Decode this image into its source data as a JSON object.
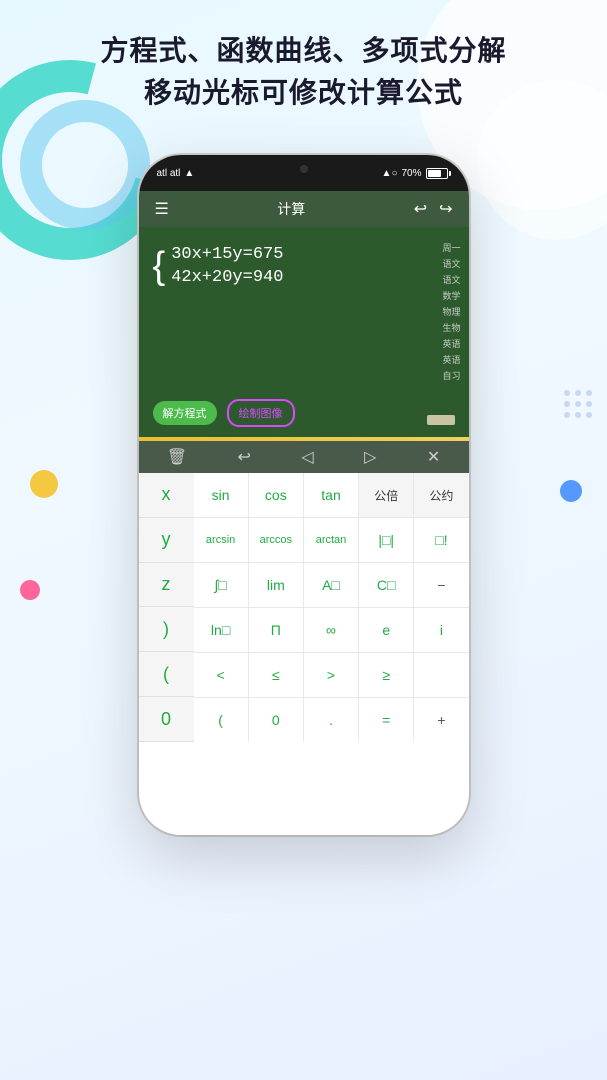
{
  "header": {
    "line1": "方程式、函数曲线、多项式分解",
    "line2": "移动光标可修改计算公式"
  },
  "phone": {
    "status": {
      "left": "atl atl",
      "wifi": "▲",
      "time": "▲ ○",
      "battery_pct": "70%"
    },
    "toolbar": {
      "menu_icon": "☰",
      "title": "计算",
      "undo_icon": "↩",
      "redo_icon": "↪"
    },
    "chalkboard": {
      "equation1": "30x+15y=675",
      "equation2": "42x+20y=940",
      "sidebar_labels": [
        "周一",
        "语文",
        "语文",
        "数学",
        "物理",
        "生物",
        "英语",
        "英语",
        "自习"
      ],
      "btn_solve": "解方程式",
      "btn_draw": "绘制图像"
    },
    "action_bar": {
      "icons": [
        "🗑",
        "↩",
        "◁",
        "▷",
        "✕"
      ]
    },
    "keyboard": {
      "left_keys": [
        "x",
        "y",
        "z",
        ")",
        "(",
        "0"
      ],
      "row1": [
        "sin",
        "cos",
        "tan",
        "公倍",
        "公约"
      ],
      "row2": [
        "arcsin",
        "arccos",
        "arctan",
        "|□|",
        "□!"
      ],
      "row3": [
        "∫□",
        "lim",
        "A□",
        "C□",
        "−"
      ],
      "row4": [
        "ln□",
        "Π",
        "∞",
        "e",
        "i"
      ],
      "row5": [
        "<",
        "≤",
        ">",
        "≥",
        ""
      ],
      "row6": [
        "(",
        "0",
        ".",
        "=",
        "+"
      ]
    }
  },
  "colors": {
    "teal": "#3dd8c8",
    "blue": "#5599ff",
    "yellow": "#f5c842",
    "pink": "#ff6699",
    "green_text": "#22aa44",
    "chalkboard": "#2d5a2d",
    "toolbar": "#3d5a3e"
  }
}
